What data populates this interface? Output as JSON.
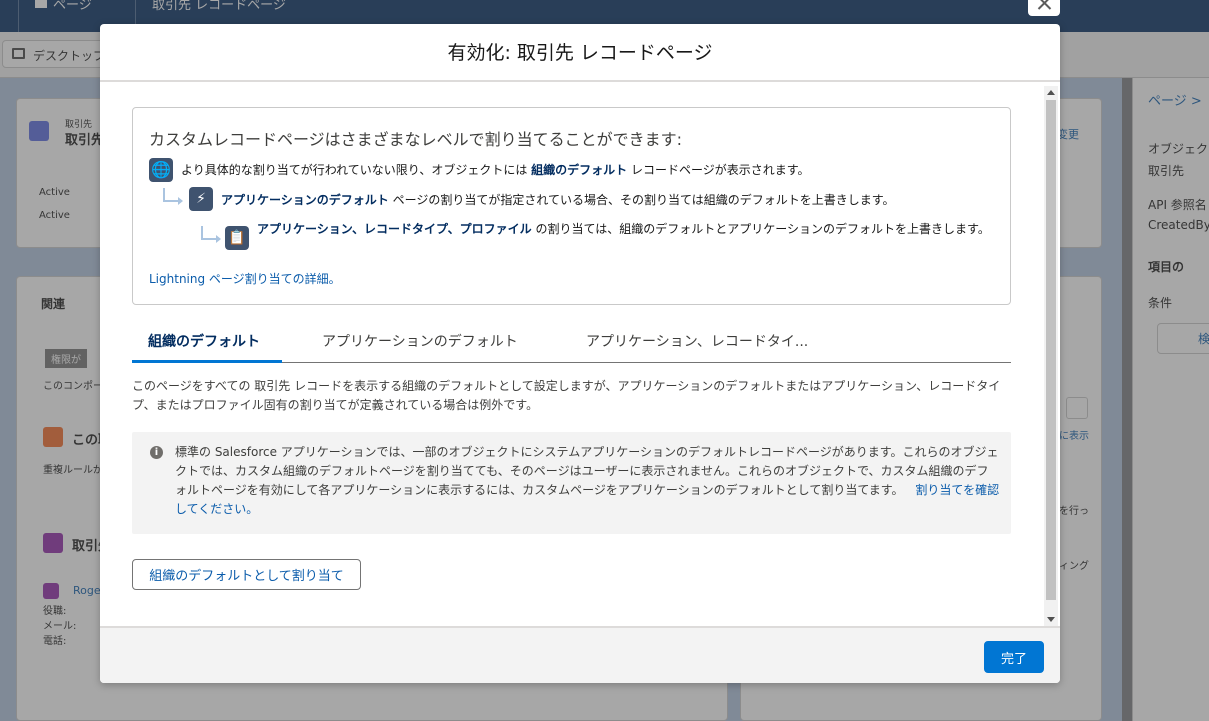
{
  "background": {
    "topbar": {
      "pages_label": "ページ",
      "breadcrumb": "取引先 レコードページ"
    },
    "toolbar": {
      "device_label": "デスクトップ"
    },
    "canvas": {
      "header_object": "取引先",
      "header_title": "取引先",
      "edit_label": "変更",
      "field_1": "Active",
      "field_2": "Active",
      "related_tab": "関連",
      "permission_label": "権限が",
      "component_label": "このコンポー",
      "section_1_title": "この取",
      "duplicate_text": "重複ルールが",
      "section_2_title": "取引先",
      "contact_name": "Roger",
      "contact_role": "役職:",
      "contact_email": "メール:",
      "contact_phone": "電話:",
      "right_link": "に表示",
      "right_text_1": "を行っ",
      "right_text_2": "ィング"
    },
    "right_panel": {
      "breadcrumb": "ページ >",
      "object_label": "オブジェク",
      "object_value": "取引先",
      "api_label": "API 参照名",
      "api_value": "CreatedByI",
      "section_label": "項目の",
      "condition_label": "条件",
      "add_label": "検"
    }
  },
  "modal": {
    "title": "有効化: 取引先 レコードページ",
    "info": {
      "heading": "カスタムレコードページはさまざまなレベルで割り当てることができます:",
      "line1_prefix": "より具体的な割り当てが行われていない限り、オブジェクトには",
      "line1_bold": "組織のデフォルト",
      "line1_suffix": "レコードページが表示されます。",
      "line2_bold": "アプリケーションのデフォルト",
      "line2_suffix": "ページの割り当てが指定されている場合、その割り当ては組織のデフォルトを上書きします。",
      "line3_bold": "アプリケーション、レコードタイプ、プロファイル",
      "line3_suffix": "の割り当ては、組織のデフォルトとアプリケーションのデフォルトを上書きします。",
      "link": "Lightning ページ割り当ての詳細。"
    },
    "tabs": [
      {
        "label": "組織のデフォルト",
        "active": true
      },
      {
        "label": "アプリケーションのデフォルト",
        "active": false
      },
      {
        "label": "アプリケーション、レコードタイ...",
        "active": false
      }
    ],
    "description": "このページをすべての 取引先 レコードを表示する組織のデフォルトとして設定しますが、アプリケーションのデフォルトまたはアプリケーション、レコードタイプ、またはプロファイル固有の割り当てが定義されている場合は例外です。",
    "notice_text": "標準の Salesforce アプリケーションでは、一部のオブジェクトにシステムアプリケーションのデフォルトレコードページがあります。これらのオブジェクトでは、カスタム組織のデフォルトページを割り当てても、そのページはユーザーに表示されません。これらのオブジェクトで、カスタム組織のデフォルトページを有効にして各アプリケーションに表示するには、カスタムページをアプリケーションのデフォルトとして割り当てます。",
    "notice_link": "割り当てを確認してください。",
    "assign_button": "組織のデフォルトとして割り当て",
    "done_button": "完了"
  },
  "colors": {
    "brand": "#0176d3",
    "link": "#0b5cab",
    "header_navy": "#032d60",
    "icon_slate": "#3f536f"
  }
}
